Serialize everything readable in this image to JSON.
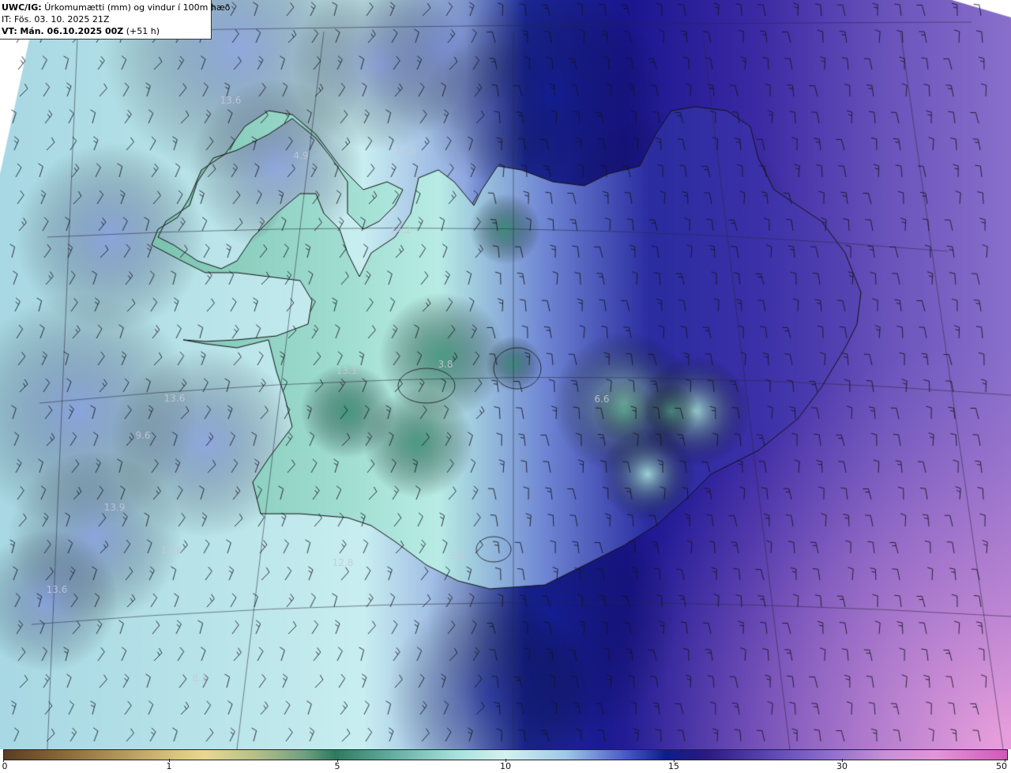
{
  "header": {
    "model_prefix": "UWC/IG:",
    "title": "Úrkomumætti (mm) og vindur í 100m hæð",
    "issue_time": "IT: Fös. 03. 10. 2025 21Z",
    "valid_prefix": "VT:",
    "valid_time": "Mán. 06.10.2025 00Z",
    "lead_time": "(+51 h)"
  },
  "map": {
    "region": "Iceland",
    "field": "precipitable water (mm)",
    "overlay": "wind barbs 100m",
    "value_labels": [
      {
        "text": "13.6"
      },
      {
        "text": "13.8"
      },
      {
        "text": "4.9"
      },
      {
        "text": "14.2"
      },
      {
        "text": "3.8"
      },
      {
        "text": "13.1"
      },
      {
        "text": "6.6"
      },
      {
        "text": "13.6"
      },
      {
        "text": "9.6"
      },
      {
        "text": "13.9"
      },
      {
        "text": "13.8"
      },
      {
        "text": "13.6"
      },
      {
        "text": "8.1"
      },
      {
        "text": "12.8"
      },
      {
        "text": "3.6"
      }
    ]
  },
  "colorbar": {
    "ticks": [
      {
        "label": "0",
        "value": 0
      },
      {
        "label": "1",
        "value": 1
      },
      {
        "label": "5",
        "value": 5
      },
      {
        "label": "10",
        "value": 10
      },
      {
        "label": "15",
        "value": 15
      },
      {
        "label": "30",
        "value": 30
      },
      {
        "label": "50",
        "value": 50
      }
    ]
  },
  "colors": {
    "low_dry": "#5a3c22",
    "green": "#2f7a5e",
    "pale_cyan": "#d4f2f0",
    "deep_blue": "#0c1c8c",
    "purple": "#5a44b0",
    "pink": "#e494d8"
  }
}
